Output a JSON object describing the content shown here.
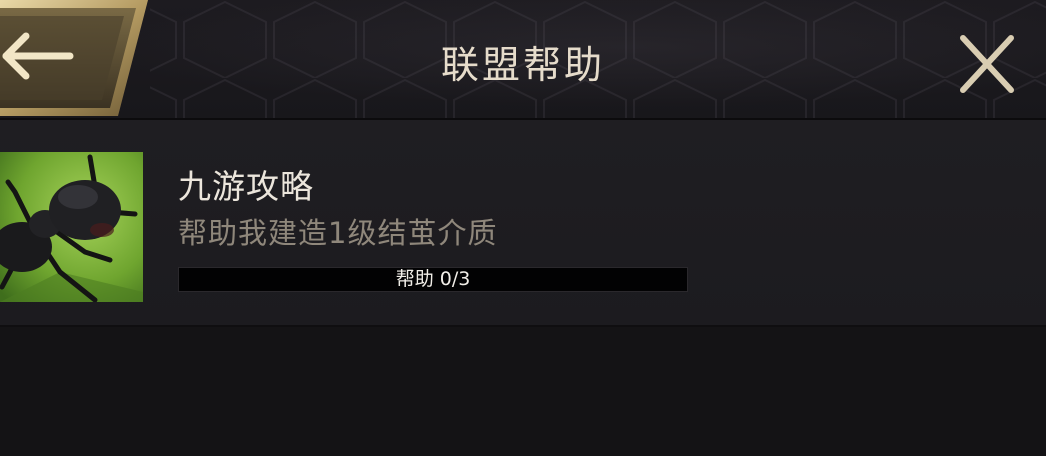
{
  "header": {
    "title": "联盟帮助",
    "back_icon": "back-arrow-icon",
    "close_icon": "close-icon"
  },
  "help_requests": [
    {
      "player_name": "九游攻略",
      "request_text": "帮助我建造1级结茧介质",
      "progress_label": "帮助 0/3",
      "progress_current": 0,
      "progress_total": 3,
      "avatar_icon": "ant-avatar-image"
    }
  ],
  "colors": {
    "accent_gold": "#c8b58a",
    "title_text": "#e6dccb",
    "secondary_text": "#8f877b",
    "background": "#151416"
  }
}
